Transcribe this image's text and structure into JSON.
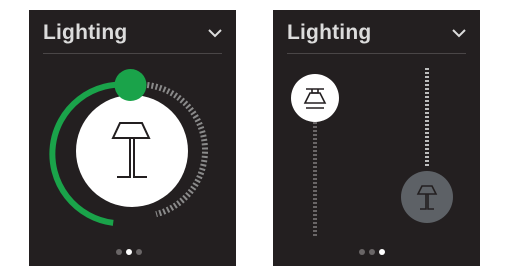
{
  "panels": [
    {
      "title": "Lighting",
      "control": "dial",
      "dial": {
        "level": 0.44,
        "accent": "#1aa34a"
      },
      "lamp_icon": "table-lamp-icon",
      "pager": {
        "count": 3,
        "active": 1
      }
    },
    {
      "title": "Lighting",
      "control": "dual-slider",
      "sliders": [
        {
          "icon": "ceiling-lamp-icon",
          "level": 1.0
        },
        {
          "icon": "table-lamp-icon",
          "level": 0.0
        }
      ],
      "pager": {
        "count": 3,
        "active": 2
      }
    }
  ],
  "colors": {
    "panel_bg": "#231f20",
    "accent": "#1aa34a",
    "knob_inactive": "#5d6166",
    "text": "#dcdcdc"
  }
}
